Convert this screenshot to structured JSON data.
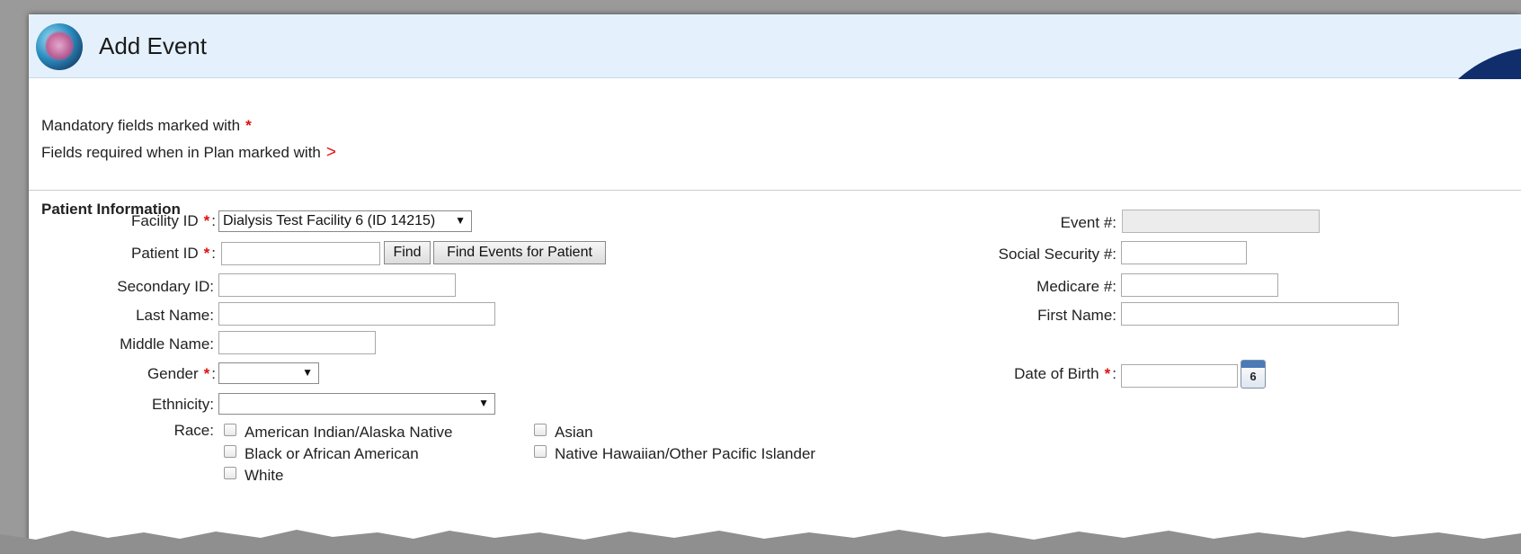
{
  "header": {
    "title": "Add Event",
    "logo_icon": "dialysis-logo-icon"
  },
  "notes": {
    "mandatory_text": "Mandatory fields marked with",
    "mandatory_marker": "*",
    "plan_text": "Fields required when in Plan marked with",
    "plan_marker": ">"
  },
  "section_title": "Patient Information",
  "fields": {
    "facility_id": {
      "label": "Facility ID",
      "value": "Dialysis Test Facility 6 (ID 14215)"
    },
    "patient_id": {
      "label": "Patient ID",
      "value": ""
    },
    "find_button": "Find",
    "find_events_button": "Find Events for Patient",
    "secondary_id": {
      "label": "Secondary ID:",
      "value": ""
    },
    "last_name": {
      "label": "Last Name:",
      "value": ""
    },
    "middle_name": {
      "label": "Middle Name:",
      "value": ""
    },
    "gender": {
      "label": "Gender",
      "value": ""
    },
    "ethnicity": {
      "label": "Ethnicity:",
      "value": ""
    },
    "race_label": "Race:",
    "event_num": {
      "label": "Event #:",
      "value": ""
    },
    "ssn": {
      "label": "Social Security #:",
      "value": ""
    },
    "medicare": {
      "label": "Medicare #:",
      "value": ""
    },
    "first_name": {
      "label": "First Name:",
      "value": ""
    },
    "dob": {
      "label": "Date of Birth",
      "value": ""
    },
    "calendar_day": "6",
    "colon": ":",
    "required_star": "*"
  },
  "race_options": [
    "American Indian/Alaska Native",
    "Asian",
    "Black or African American",
    "Native Hawaiian/Other Pacific Islander",
    "White"
  ],
  "colors": {
    "header_bg": "#e4f1fc",
    "required": "#e01010"
  }
}
